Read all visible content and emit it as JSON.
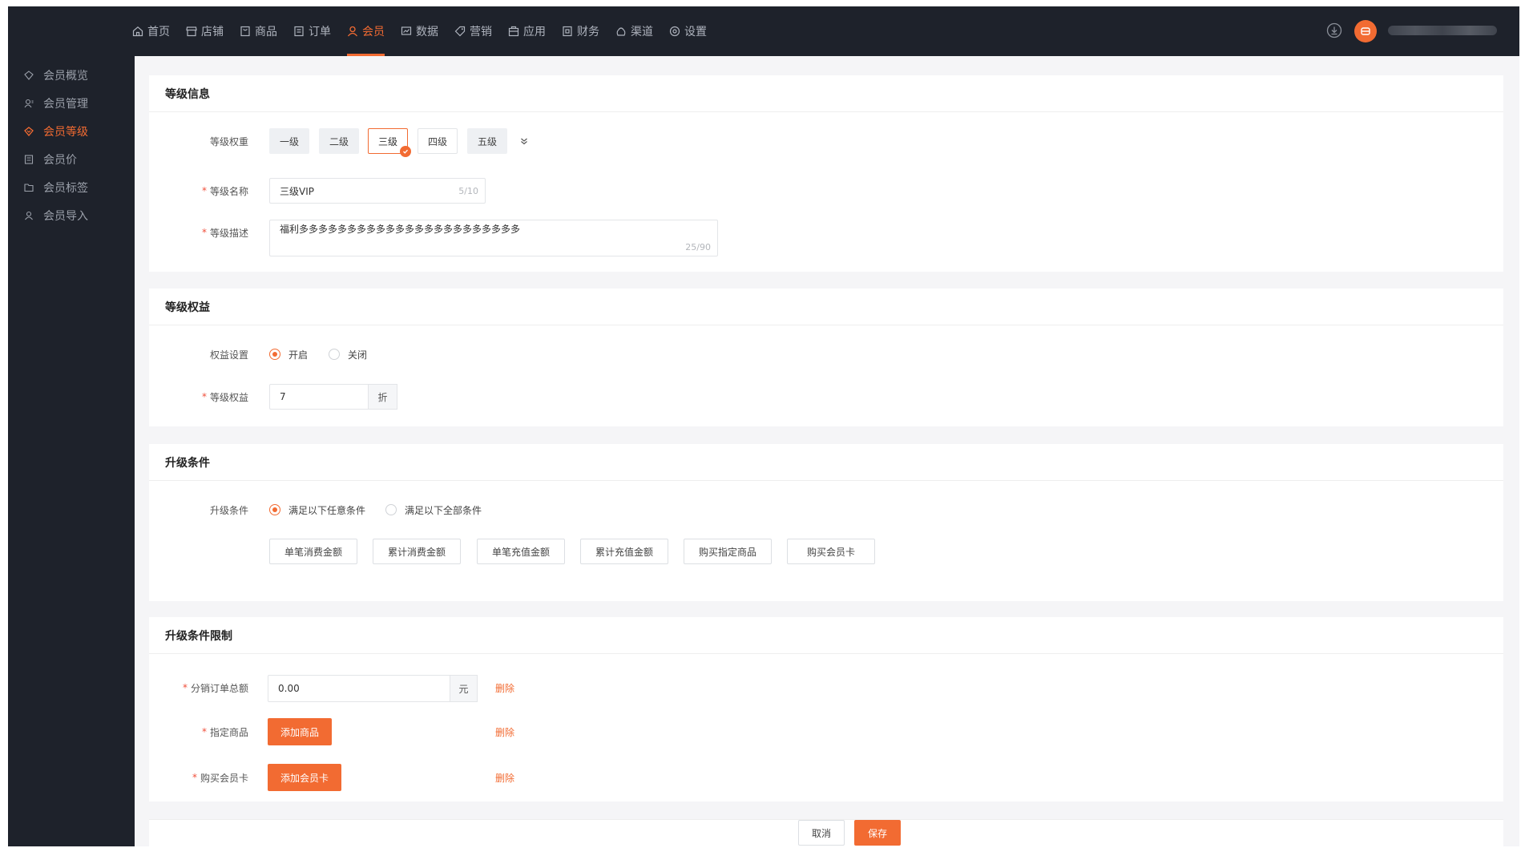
{
  "nav": {
    "items": [
      {
        "label": "首页",
        "icon": "home-icon"
      },
      {
        "label": "店铺",
        "icon": "store-icon"
      },
      {
        "label": "商品",
        "icon": "product-icon"
      },
      {
        "label": "订单",
        "icon": "order-icon"
      },
      {
        "label": "会员",
        "icon": "member-icon"
      },
      {
        "label": "数据",
        "icon": "data-icon"
      },
      {
        "label": "营销",
        "icon": "tag-icon"
      },
      {
        "label": "应用",
        "icon": "app-icon"
      },
      {
        "label": "财务",
        "icon": "finance-icon"
      },
      {
        "label": "渠道",
        "icon": "channel-icon"
      },
      {
        "label": "设置",
        "icon": "gear-icon"
      }
    ],
    "active_index": 4
  },
  "sidebar": {
    "items": [
      {
        "label": "会员概览",
        "icon": "overview-icon"
      },
      {
        "label": "会员管理",
        "icon": "user-manage-icon"
      },
      {
        "label": "会员等级",
        "icon": "level-icon"
      },
      {
        "label": "会员价",
        "icon": "price-icon"
      },
      {
        "label": "会员标签",
        "icon": "label-icon"
      },
      {
        "label": "会员导入",
        "icon": "import-icon"
      }
    ],
    "active_index": 2
  },
  "level_info": {
    "title": "等级信息",
    "weight_label": "等级权重",
    "weights": [
      "一级",
      "二级",
      "三级",
      "四级",
      "五级"
    ],
    "selected_weight": 2,
    "name_label": "等级名称",
    "name_value": "三级VIP",
    "name_count": "5/10",
    "desc_label": "等级描述",
    "desc_value": "福利多多多多多多多多多多多多多多多多多多多多多多多",
    "desc_count": "25/90"
  },
  "level_rights": {
    "title": "等级权益",
    "setting_label": "权益设置",
    "on_label": "开启",
    "off_label": "关闭",
    "discount_label": "等级权益",
    "discount_value": "7",
    "discount_unit": "折"
  },
  "upgrade": {
    "title": "升级条件",
    "condition_label": "升级条件",
    "any_label": "满足以下任意条件",
    "all_label": "满足以下全部条件",
    "buttons": [
      "单笔消费金额",
      "累计消费金额",
      "单笔充值金额",
      "累计充值金额",
      "购买指定商品",
      "购买会员卡"
    ]
  },
  "limits": {
    "title": "升级条件限制",
    "order_total_label": "分销订单总额",
    "order_total_value": "0.00",
    "order_total_unit": "元",
    "product_label": "指定商品",
    "add_product": "添加商品",
    "card_label": "购买会员卡",
    "add_card": "添加会员卡",
    "delete": "删除"
  },
  "footer": {
    "cancel": "取消",
    "save": "保存"
  },
  "colors": {
    "accent": "#f26b32",
    "dark": "#1e222b"
  }
}
